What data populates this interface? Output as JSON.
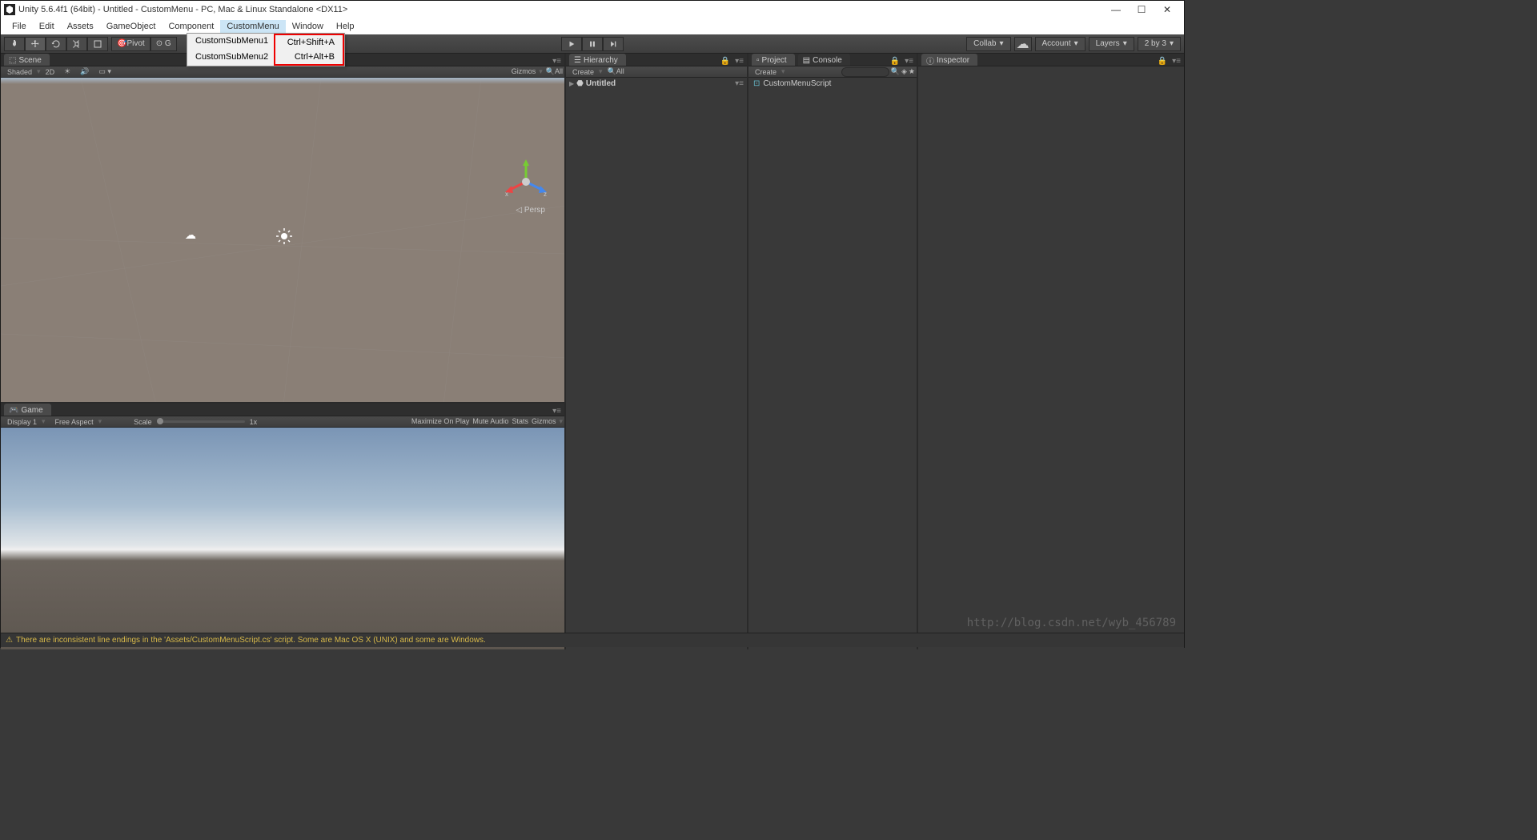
{
  "titlebar": {
    "title": "Unity 5.6.4f1 (64bit) - Untitled - CustomMenu - PC, Mac & Linux Standalone <DX11>"
  },
  "menubar": {
    "items": [
      "File",
      "Edit",
      "Assets",
      "GameObject",
      "Component",
      "CustomMenu",
      "Window",
      "Help"
    ],
    "active": "CustomMenu"
  },
  "dropdown": {
    "items": [
      {
        "label": "CustomSubMenu1",
        "shortcut": "Ctrl+Shift+A"
      },
      {
        "label": "CustomSubMenu2",
        "shortcut": "Ctrl+Alt+B"
      }
    ]
  },
  "toolbar": {
    "pivot": "Pivot",
    "collab": "Collab",
    "account": "Account",
    "layers": "Layers",
    "layout": "2 by 3"
  },
  "scene": {
    "tab": "Scene",
    "shaded": "Shaded",
    "mode2d": "2D",
    "gizmos": "Gizmos",
    "all": "All",
    "persp": "Persp"
  },
  "game": {
    "tab": "Game",
    "display": "Display 1",
    "aspect": "Free Aspect",
    "scale": "Scale",
    "scaleval": "1x",
    "maximize": "Maximize On Play",
    "mute": "Mute Audio",
    "stats": "Stats",
    "gizmos": "Gizmos"
  },
  "hierarchy": {
    "tab": "Hierarchy",
    "create": "Create",
    "all": "All",
    "scene_name": "Untitled"
  },
  "project": {
    "tab": "Project",
    "create": "Create",
    "items": [
      "CustomMenuScript"
    ]
  },
  "console": {
    "tab": "Console"
  },
  "inspector": {
    "tab": "Inspector"
  },
  "status": {
    "message": "There are inconsistent line endings in the 'Assets/CustomMenuScript.cs' script. Some are Mac OS X (UNIX) and some are Windows."
  },
  "watermark": "http://blog.csdn.net/wyb_456789",
  "axis": {
    "x": "x",
    "z": "z"
  }
}
